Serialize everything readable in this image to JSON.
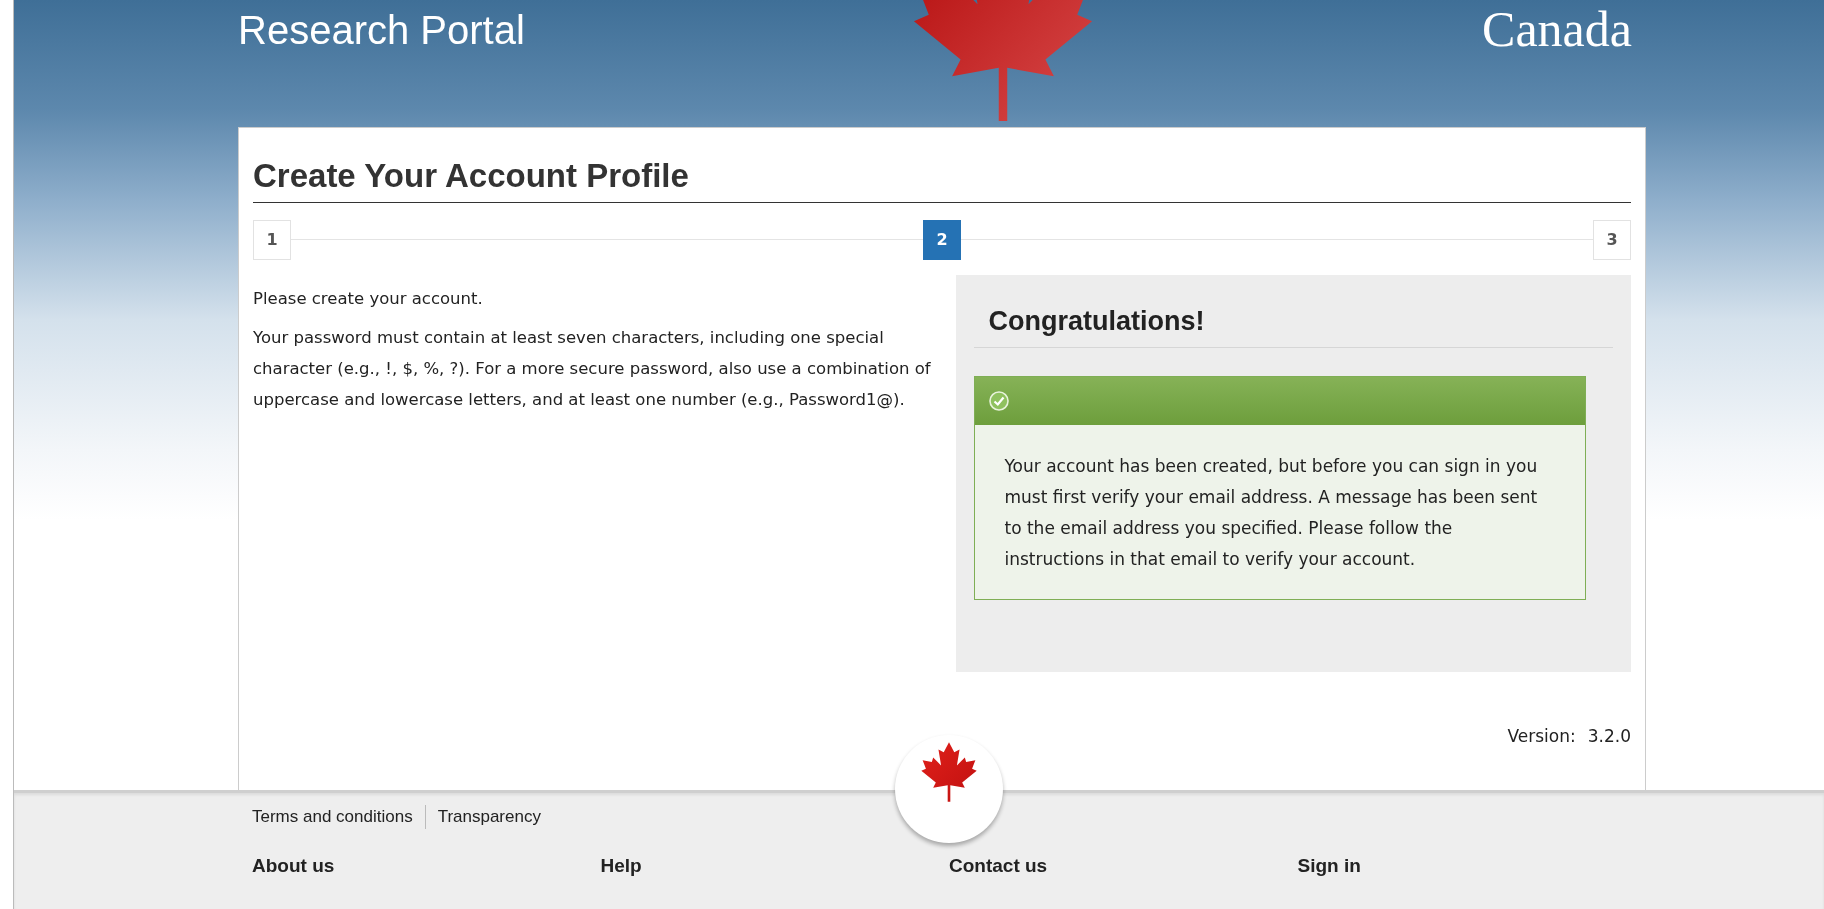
{
  "header": {
    "title": "Research Portal",
    "wordmark": "Canada"
  },
  "page": {
    "title": "Create Your Account Profile"
  },
  "steps": [
    {
      "label": "1",
      "selected": false
    },
    {
      "label": "2",
      "selected": true
    },
    {
      "label": "3",
      "selected": false
    }
  ],
  "intro": [
    "Please create your account.",
    "Your password must contain at least seven characters, including one special character (e.g., !, $, %, ?). For a more secure password, also use a combination of uppercase and lowercase letters, and at least one number (e.g., Password1@)."
  ],
  "panel": {
    "title": "Congratulations!",
    "alert": {
      "kind": "success",
      "message": "Your account has been created, but before you can sign in you must first verify your email address. A message has been sent to the email address you specified. Please follow the instructions in that email to verify your account."
    }
  },
  "version": {
    "label": "Version:",
    "value": "3.2.0"
  },
  "footer": {
    "links": [
      "Terms and conditions",
      "Transparency"
    ],
    "nav": [
      "About us",
      "Help",
      "Contact us",
      "Sign in"
    ]
  }
}
